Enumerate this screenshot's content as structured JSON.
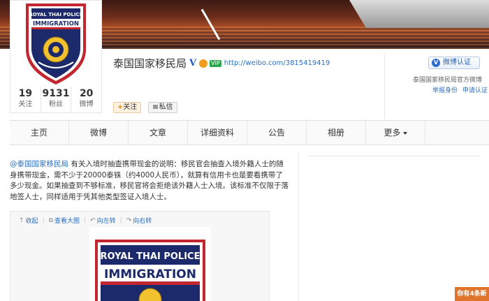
{
  "profile": {
    "name": "泰国国家移民局",
    "verified_mark": "V",
    "vip_badge": "VIP",
    "url": "http://weibo.com/3815419419",
    "logo_text_top": "ROYAL THAI POLICE",
    "logo_text_main": "IMMIGRATION",
    "stats": [
      {
        "num": "19",
        "label": "关注"
      },
      {
        "num": "9131",
        "label": "粉丝"
      },
      {
        "num": "20",
        "label": "微博"
      }
    ],
    "follow_label": "关注",
    "message_label": "私信"
  },
  "verify": {
    "badge_label": "微博认证",
    "description": "泰国国家移民局官方微博",
    "report_label": "举报身份",
    "apply_label": "申请认证"
  },
  "nav": {
    "items": [
      "主页",
      "微博",
      "文章",
      "详细资料",
      "公告",
      "相册",
      "更多"
    ]
  },
  "post": {
    "author": "@泰国国家移民局",
    "text": " 有关入境时抽查携带现金的说明：移民官会抽查入境外籍人士的随身携带现金，需不少于20000泰铢（约4000人民币），就算有信用卡也是要看携带了多少现金。如果抽查到不够标准，移民官将会拒绝该外籍人士入境。该标准不仅限于落地签人士，同样适用于凭其他类型签证入境人士。",
    "media_actions": [
      "收起",
      "查看大图",
      "向左转",
      "向右转"
    ]
  },
  "toast": {
    "text": "你有4条新"
  },
  "colors": {
    "link": "#2b6fbf",
    "accent_orange": "#e0742a",
    "logo_navy": "#1c2a6b",
    "logo_red": "#c2262e"
  }
}
